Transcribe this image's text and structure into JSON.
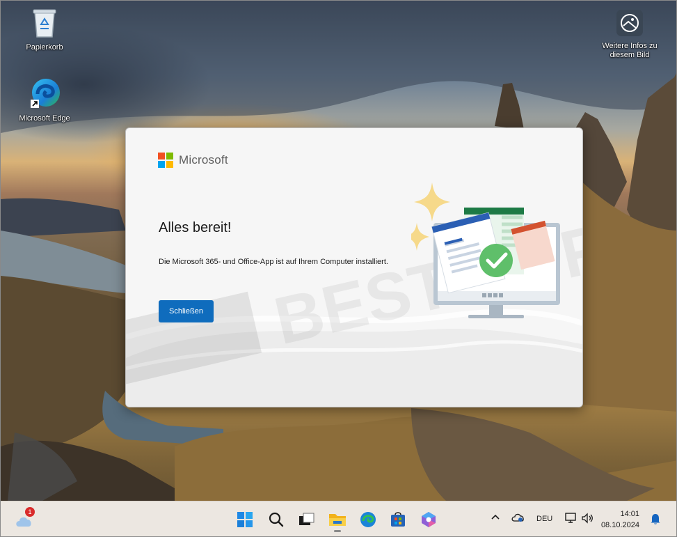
{
  "desktop": {
    "icons": [
      {
        "label": "Papierkorb",
        "icon": "recycle-bin-icon"
      },
      {
        "label": "Microsoft Edge",
        "icon": "edge-icon"
      },
      {
        "label": "Weitere Infos zu diesem Bild",
        "icon": "picture-info-icon"
      }
    ]
  },
  "dialog": {
    "brand": "Microsoft",
    "title": "Alles bereit!",
    "message": "Die Microsoft 365- und Office-App ist auf Ihrem Computer installiert.",
    "close_label": "Schließen",
    "watermark": "BEST SOFTWARE BEST"
  },
  "taskbar": {
    "weather_badge": "1",
    "language": "DEU",
    "time": "14:01",
    "date": "08.10.2024",
    "apps": [
      "start-icon",
      "search-icon",
      "task-view-icon",
      "file-explorer-icon",
      "edge-icon",
      "store-icon",
      "copilot-icon"
    ]
  },
  "colors": {
    "button": "#0f6cbd",
    "ms_red": "#f25022",
    "ms_green": "#7fba00",
    "ms_blue": "#00a4ef",
    "ms_yellow": "#ffb900"
  }
}
